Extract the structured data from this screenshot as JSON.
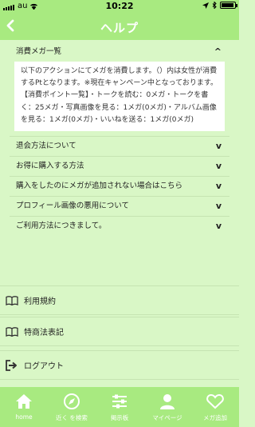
{
  "status_bar": {
    "carrier": "au",
    "time": "10:22"
  },
  "header": {
    "title": "ヘルプ",
    "back_icon": "chevron-left-icon"
  },
  "faq": [
    {
      "title": "消費メガ一覧",
      "expanded": true,
      "body": "以下のアクションにてメガを消費します。（）内は女性が消費するPtとなります。※現在キャンペーン中となっております。【消費ポイント一覧】・トークを読む：0メガ・トークを書く：25メガ・写真画像を見る：1メガ(0メガ)・アルバム画像を見る：1メガ(0メガ)・いいねを送る：1メガ(0メガ)"
    },
    {
      "title": "退会方法について"
    },
    {
      "title": "お得に購入する方法"
    },
    {
      "title": "購入をしたのにメガが追加されない場合はこちら"
    },
    {
      "title": "プロフィール画像の悪用について"
    },
    {
      "title": "ご利用方法につきまして。"
    }
  ],
  "caret_open": "^",
  "caret_closed": "v",
  "menu": [
    {
      "label": "利用規約",
      "icon": "book-icon"
    },
    {
      "label": "特商法表記",
      "icon": "book-icon"
    },
    {
      "label": "ログアウト",
      "icon": "logout-icon"
    }
  ],
  "tabbar": [
    {
      "label": "home",
      "icon": "home-icon"
    },
    {
      "label": "近く を検索",
      "icon": "compass-icon"
    },
    {
      "label": "掲示板",
      "icon": "sliders-icon"
    },
    {
      "label": "マイページ",
      "icon": "user-icon"
    },
    {
      "label": "メガ追加",
      "icon": "heart-icon"
    }
  ],
  "colors": {
    "accent": "#a8ea80",
    "background": "#d9f7c6"
  }
}
